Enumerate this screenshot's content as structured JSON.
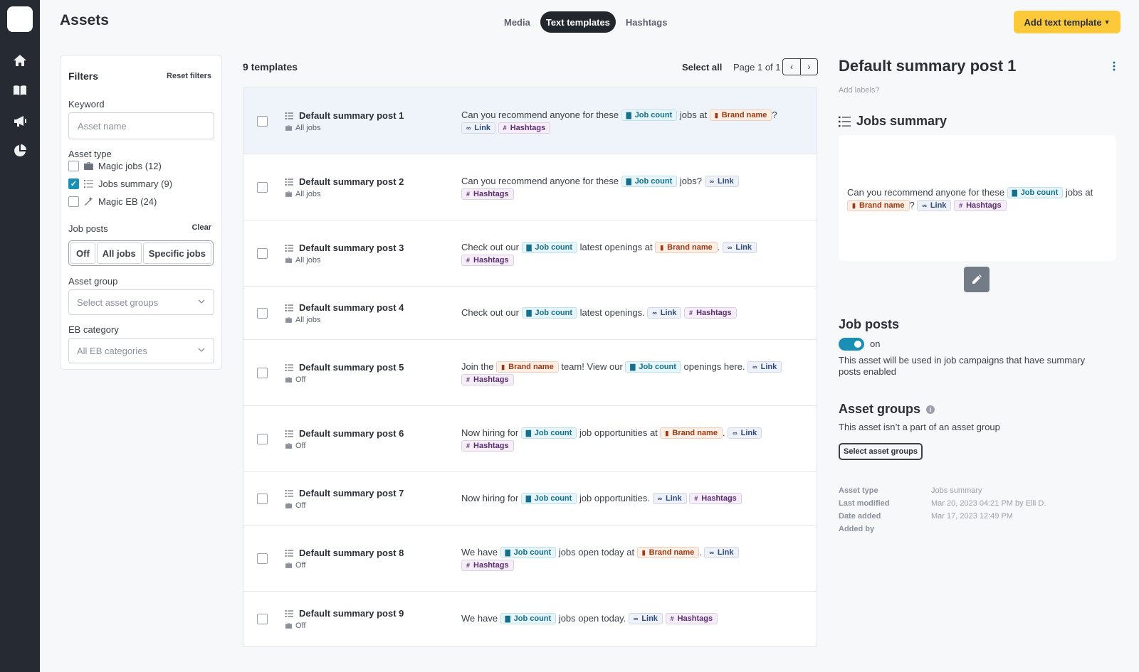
{
  "nav": {
    "icons": [
      "home-icon",
      "book-icon",
      "megaphone-icon",
      "pie-chart-icon"
    ]
  },
  "header": {
    "title": "Assets",
    "tabs": [
      {
        "label": "Media",
        "active": false
      },
      {
        "label": "Text templates",
        "active": true
      },
      {
        "label": "Hashtags",
        "active": false
      }
    ],
    "add_button": "Add text template"
  },
  "filters": {
    "title": "Filters",
    "reset": "Reset filters",
    "keyword_label": "Keyword",
    "keyword_placeholder": "Asset name",
    "asset_type_label": "Asset type",
    "asset_types": [
      {
        "label": "Magic jobs (12)",
        "checked": false,
        "icon": "briefcase-icon"
      },
      {
        "label": "Jobs summary (9)",
        "checked": true,
        "icon": "list-icon"
      },
      {
        "label": "Magic EB (24)",
        "checked": false,
        "icon": "magic-wand-icon"
      }
    ],
    "job_posts_label": "Job posts",
    "clear": "Clear",
    "job_posts_options": [
      "Off",
      "All jobs",
      "Specific jobs"
    ],
    "asset_group_label": "Asset group",
    "asset_group_placeholder": "Select asset groups",
    "eb_category_label": "EB category",
    "eb_category_value": "All EB categories"
  },
  "list": {
    "count": "9 templates",
    "select_all": "Select all",
    "page_info": "Page 1 of 1",
    "rows": [
      {
        "name": "Default summary post 1",
        "sub": "All jobs"
      },
      {
        "name": "Default summary post 2",
        "sub": "All jobs"
      },
      {
        "name": "Default summary post 3",
        "sub": "All jobs"
      },
      {
        "name": "Default summary post 4",
        "sub": "All jobs"
      },
      {
        "name": "Default summary post 5",
        "sub": "Off"
      },
      {
        "name": "Default summary post 6",
        "sub": "Off"
      },
      {
        "name": "Default summary post 7",
        "sub": "Off"
      },
      {
        "name": "Default summary post 8",
        "sub": "Off"
      },
      {
        "name": "Default summary post 9",
        "sub": "Off"
      }
    ],
    "text": {
      "recommend": "Can you recommend anyone for these",
      "jobs_at": "jobs at",
      "jobs_q": "jobs?",
      "q": "?",
      "check_out": "Check out our",
      "latest_at": "latest openings at",
      "latest": "latest openings.",
      "join_the": "Join the",
      "team_view": "team! View our",
      "openings_here": "openings here.",
      "now_hiring": "Now hiring for",
      "job_opps_at": "job opportunities at",
      "job_opps": "job opportunities.",
      "we_have": "We have",
      "open_today_at": "jobs open today at",
      "open_today": "jobs open today.",
      "dot": "."
    },
    "chips": {
      "job_count": "Job count",
      "brand_name": "Brand name",
      "link": "Link",
      "hashtags": "Hashtags"
    }
  },
  "detail": {
    "title": "Default summary post 1",
    "add_labels": "Add labels?",
    "type": "Jobs summary",
    "preview_text_1": "Can you recommend anyone for these",
    "preview_text_2": "jobs",
    "preview_text_3": "at",
    "preview_text_4": "?",
    "job_posts_title": "Job posts",
    "toggle_label": "on",
    "job_posts_desc": "This asset will be used in job campaigns that have summary posts enabled",
    "asset_groups_title": "Asset groups",
    "asset_groups_desc": "This asset isn’t a part of an asset group",
    "select_asset_groups": "Select asset groups",
    "meta": [
      {
        "key": "Asset type",
        "value": "Jobs summary"
      },
      {
        "key": "Last modified",
        "value": "Mar 20, 2023 04:21 PM by Elli D."
      },
      {
        "key": "Date added",
        "value": "Mar 17, 2023 12:49 PM"
      },
      {
        "key": "Added by",
        "value": ""
      }
    ]
  },
  "colors": {
    "accent": "#1a8fb5",
    "cta": "#fcc93a",
    "rail": "#262b33"
  }
}
